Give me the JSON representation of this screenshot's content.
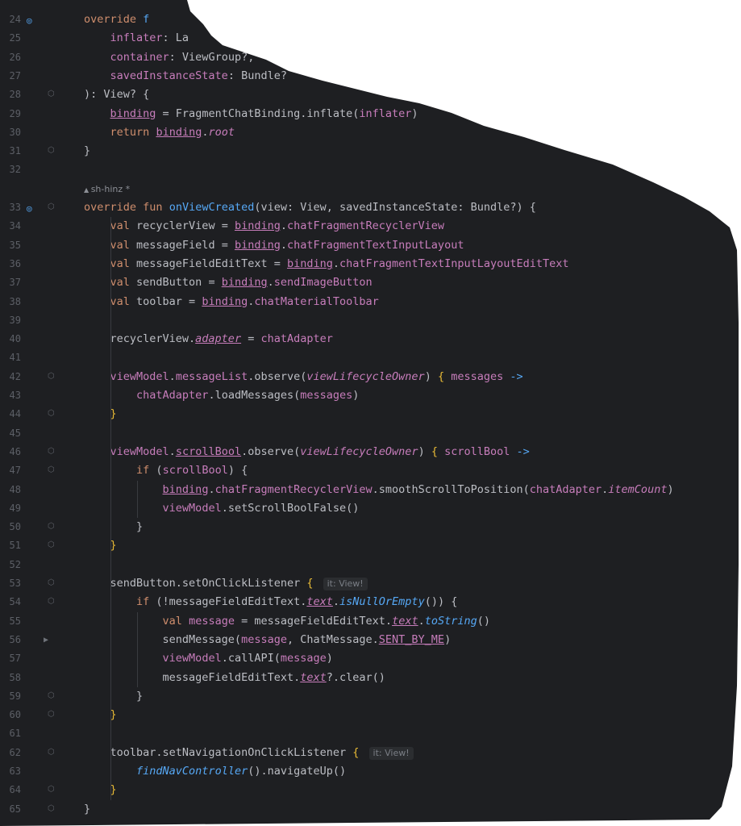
{
  "editor": {
    "lines": [
      {
        "num": "24",
        "html": "<span class='kw'>override</span> <span class='fn'>f</span>"
      },
      {
        "num": "25",
        "html": "    <span class='prop'>inflater</span>: La"
      },
      {
        "num": "26",
        "html": "    <span class='prop'>container</span>: ViewGroup?,"
      },
      {
        "num": "27",
        "html": "    <span class='prop'>savedInstanceState</span>: Bundle?"
      },
      {
        "num": "28",
        "html": "): View? {"
      },
      {
        "num": "29",
        "html": "    <span class='prop ul'>binding</span> = FragmentChatBinding.inflate(<span class='prop'>inflater</span>)"
      },
      {
        "num": "30",
        "html": "    <span class='kw'>return</span> <span class='prop ul'>binding</span>.<span class='prop ital'>root</span>"
      },
      {
        "num": "31",
        "html": "}"
      },
      {
        "num": "32",
        "html": ""
      },
      {
        "num": "",
        "hint": "sh-hinz *"
      },
      {
        "num": "33",
        "html": "<span class='kw'>override fun</span> <span class='fn'>onViewCreated</span>(<span class='param'>view</span>: View, <span class='param'>savedInstanceState</span>: Bundle?) {"
      },
      {
        "num": "34",
        "html": "    <span class='kw'>val</span> recyclerView = <span class='prop ul'>binding</span>.<span class='prop'>chatFragmentRecyclerView</span>"
      },
      {
        "num": "35",
        "html": "    <span class='kw'>val</span> messageField = <span class='prop ul'>binding</span>.<span class='prop'>chatFragmentTextInputLayout</span>"
      },
      {
        "num": "36",
        "html": "    <span class='kw'>val</span> messageFieldEditText = <span class='prop ul'>binding</span>.<span class='prop'>chatFragmentTextInputLayoutEditText</span>"
      },
      {
        "num": "37",
        "html": "    <span class='kw'>val</span> sendButton = <span class='prop ul'>binding</span>.<span class='prop'>sendImageButton</span>"
      },
      {
        "num": "38",
        "html": "    <span class='kw'>val</span> toolbar = <span class='prop ul'>binding</span>.<span class='prop'>chatMaterialToolbar</span>"
      },
      {
        "num": "39",
        "html": ""
      },
      {
        "num": "40",
        "html": "    recyclerView.<span class='prop ital ul'>adapter</span> = <span class='prop'>chatAdapter</span>"
      },
      {
        "num": "41",
        "html": ""
      },
      {
        "num": "42",
        "html": "    <span class='prop'>viewModel</span>.<span class='prop'>messageList</span>.observe(<span class='prop ital'>viewLifecycleOwner</span>) <span class='yel'>{</span> <span class='lam'>messages</span> <span class='fn'>-&gt;</span>"
      },
      {
        "num": "43",
        "html": "        <span class='prop'>chatAdapter</span>.loadMessages(<span class='lam'>messages</span>)"
      },
      {
        "num": "44",
        "html": "    <span class='yel'>}</span>"
      },
      {
        "num": "45",
        "html": ""
      },
      {
        "num": "46",
        "html": "    <span class='prop'>viewModel</span>.<span class='prop ul'>scrollBool</span>.observe(<span class='prop ital'>viewLifecycleOwner</span>) <span class='yel'>{</span> <span class='lam'>scrollBool</span> <span class='fn'>-&gt;</span>"
      },
      {
        "num": "47",
        "html": "        <span class='kw'>if</span> (<span class='lam'>scrollBool</span>) {"
      },
      {
        "num": "48",
        "html": "            <span class='prop ul'>binding</span>.<span class='prop'>chatFragmentRecyclerView</span>.smoothScrollToPosition(<span class='prop'>chatAdapter</span>.<span class='prop ital'>itemCount</span>)"
      },
      {
        "num": "49",
        "html": "            <span class='prop'>viewModel</span>.setScrollBoolFalse()"
      },
      {
        "num": "50",
        "html": "        }"
      },
      {
        "num": "51",
        "html": "    <span class='yel'>}</span>"
      },
      {
        "num": "52",
        "html": ""
      },
      {
        "num": "53",
        "html": "    sendButton.setOnClickListener <span class='yel'>{</span> <span class='hint'>it: View!</span>"
      },
      {
        "num": "54",
        "html": "        <span class='kw'>if</span> (!messageFieldEditText.<span class='prop ital ul'>text</span>.<span class='fn ital'>isNullOrEmpty</span>()) {"
      },
      {
        "num": "55",
        "html": "            <span class='kw'>val</span> <span class='prop'>message</span> = messageFieldEditText.<span class='prop ital ul'>text</span>.<span class='fn ital'>toString</span>()"
      },
      {
        "num": "56",
        "html": "            sendMessage(<span class='prop'>message</span>, ChatMessage.<span class='prop ul'>SENT_BY_ME</span>)"
      },
      {
        "num": "57",
        "html": "            <span class='prop'>viewModel</span>.callAPI(<span class='prop'>message</span>)"
      },
      {
        "num": "58",
        "html": "            messageFieldEditText.<span class='prop ital ul'>text</span>?.clear()"
      },
      {
        "num": "59",
        "html": "        }"
      },
      {
        "num": "60",
        "html": "    <span class='yel'>}</span>"
      },
      {
        "num": "61",
        "html": ""
      },
      {
        "num": "62",
        "html": "    toolbar.setNavigationOnClickListener <span class='yel'>{</span> <span class='hint'>it: View!</span>"
      },
      {
        "num": "63",
        "html": "        <span class='fn ital'>findNavController</span>().navigateUp()"
      },
      {
        "num": "64",
        "html": "    <span class='yel'>}</span>"
      },
      {
        "num": "65",
        "html": "}"
      }
    ]
  }
}
